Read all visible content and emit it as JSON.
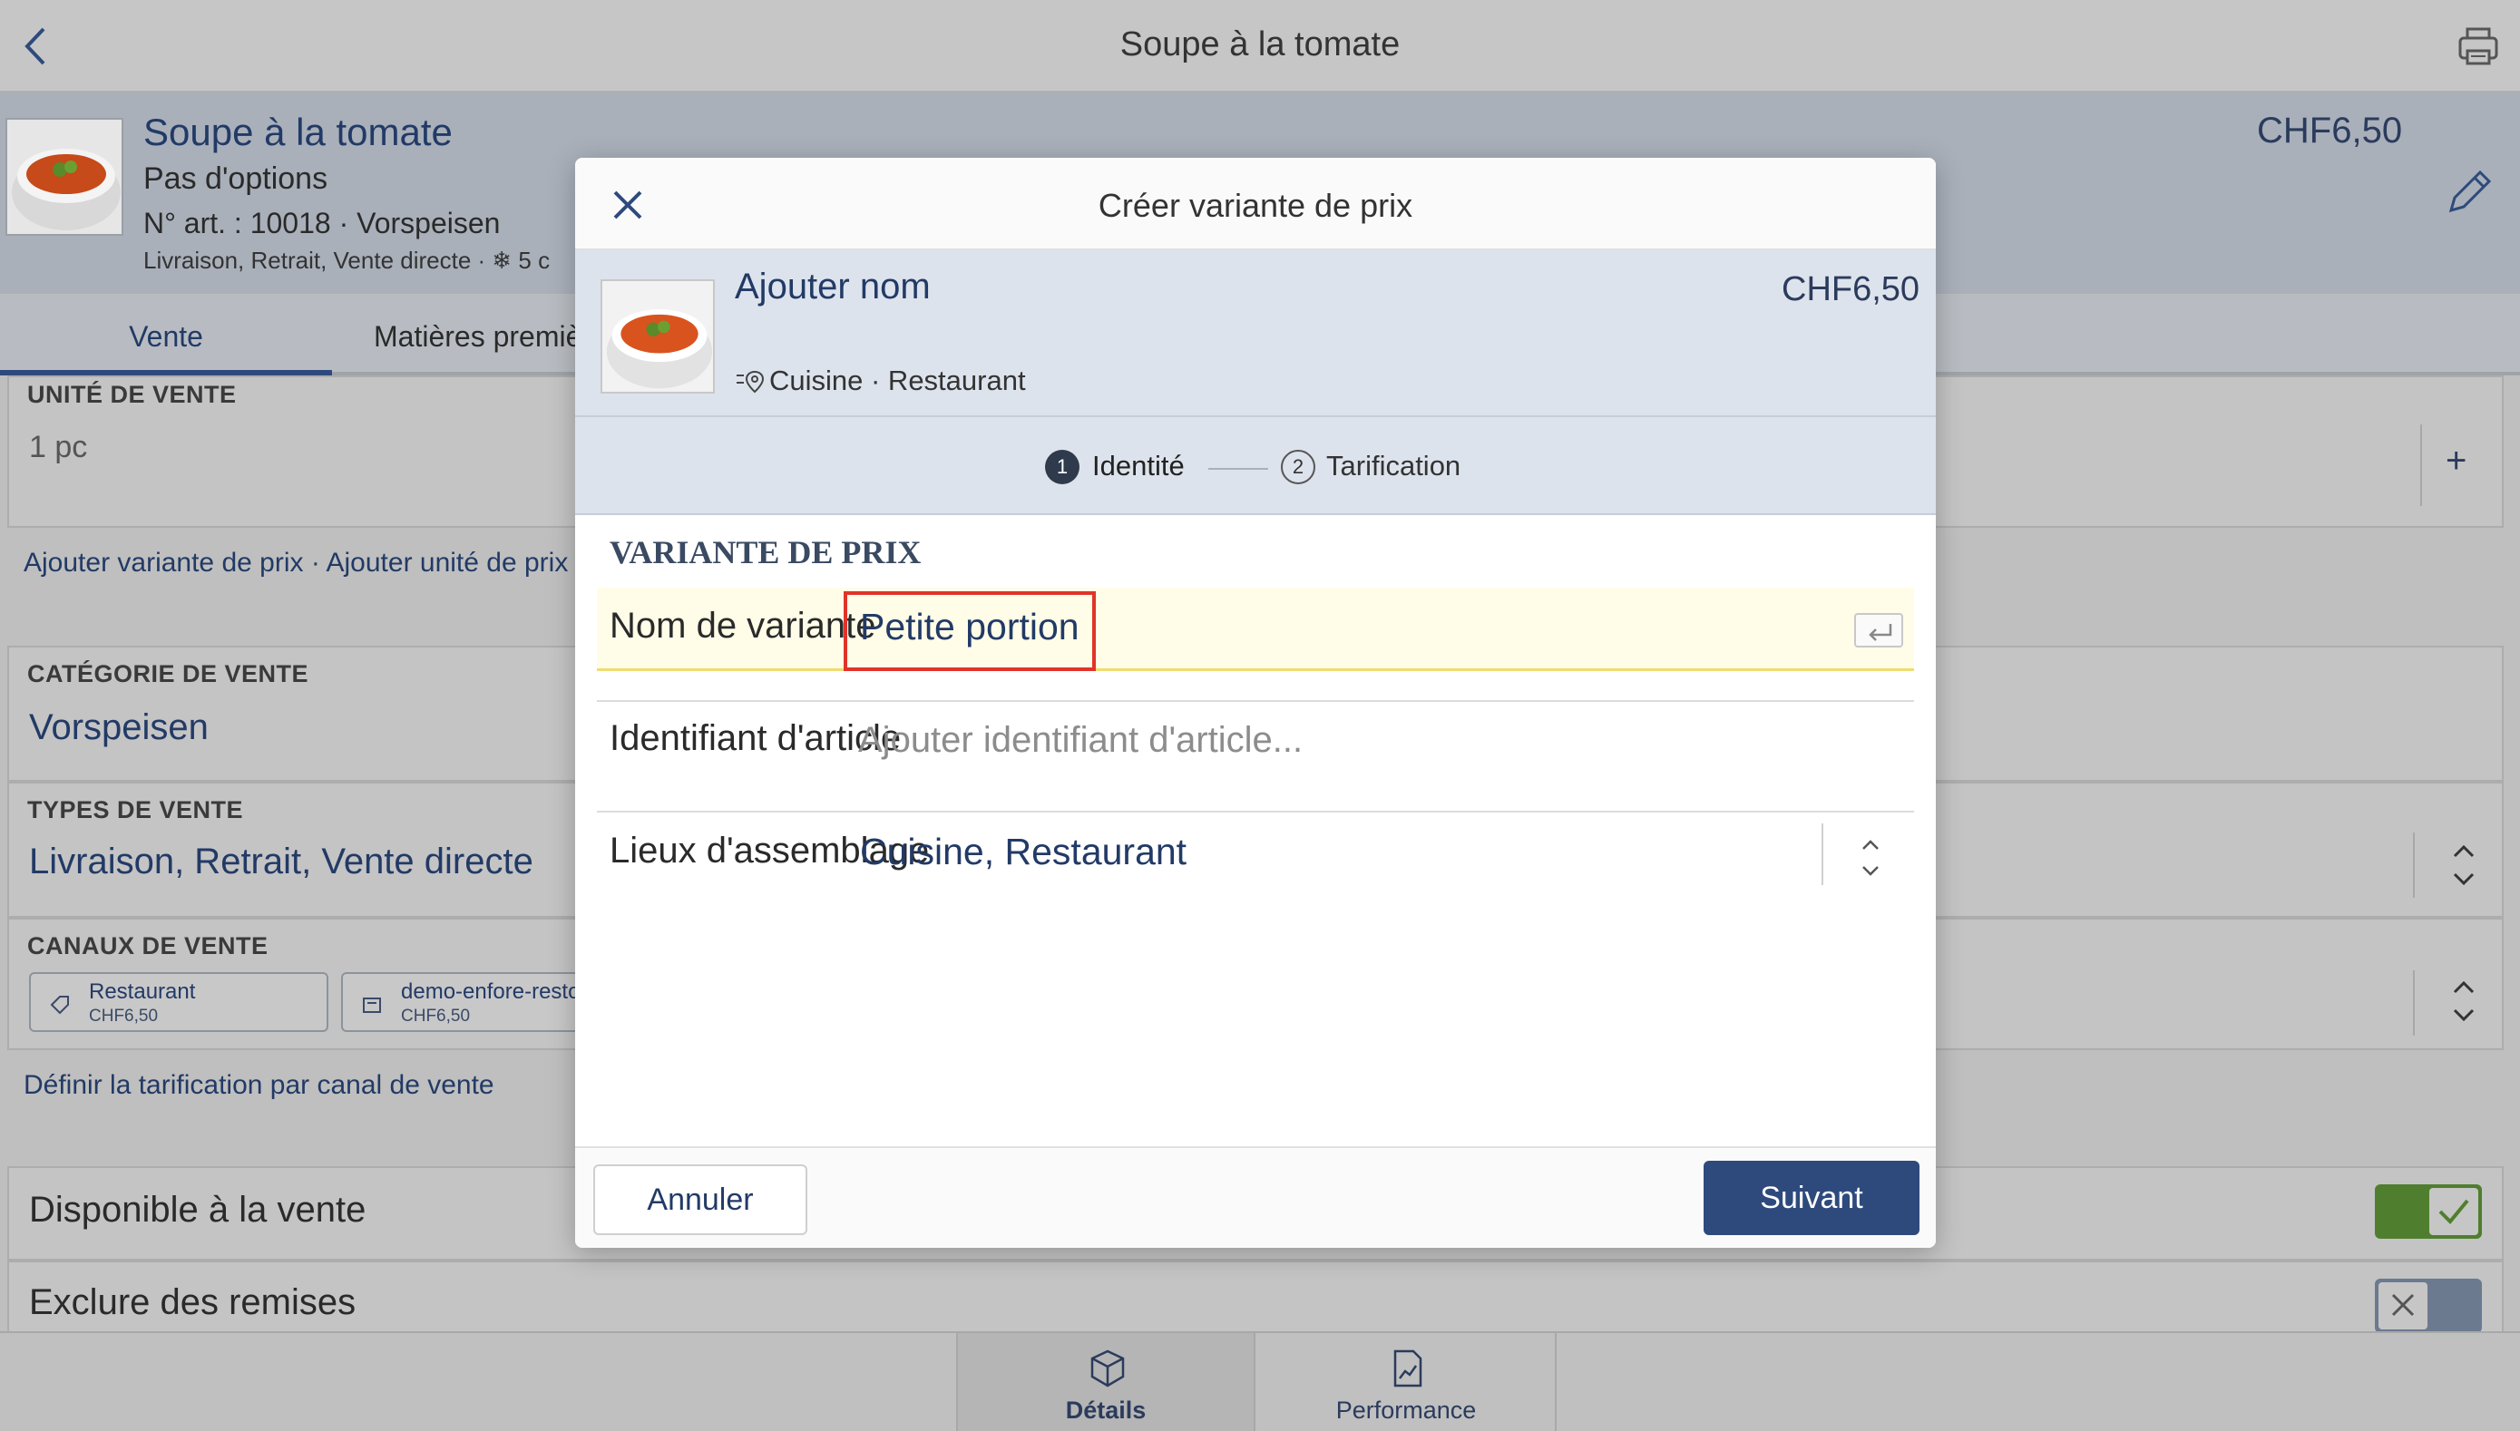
{
  "app": {
    "title": "Soupe à la tomate"
  },
  "product": {
    "name": "Soupe à la tomate",
    "options": "Pas d'options",
    "article": "N° art. : 10018 · Vorspeisen",
    "meta": "Livraison, Retrait, Vente directe · ❄ 5 c",
    "price": "CHF6,50"
  },
  "tabs": [
    {
      "label": "Vente",
      "active": true
    },
    {
      "label": "Matières premières",
      "active": false
    }
  ],
  "sale_unit": {
    "label": "UNITÉ DE VENTE",
    "value": "1 pc",
    "add": "+"
  },
  "links": {
    "add_variant_unit": "Ajouter variante de prix · Ajouter unité de prix",
    "channel_pricing": "Définir la tarification par canal de vente"
  },
  "category": {
    "label": "CATÉGORIE DE VENTE",
    "value": "Vorspeisen"
  },
  "sale_types": {
    "label": "TYPES DE VENTE",
    "value": "Livraison, Retrait, Vente directe"
  },
  "channels": {
    "label": "CANAUX DE VENTE",
    "items": [
      {
        "name": "Restaurant",
        "price": "CHF6,50"
      },
      {
        "name": "demo-enfore-resto-",
        "price": "CHF6,50"
      }
    ]
  },
  "toggles": {
    "available": {
      "label": "Disponible à la vente",
      "on": true
    },
    "exclude": {
      "label": "Exclure des remises",
      "on": false
    }
  },
  "bottom_nav": [
    {
      "label": "Détails",
      "active": true
    },
    {
      "label": "Performance",
      "active": false
    }
  ],
  "modal": {
    "title": "Créer variante de prix",
    "product_name": "Ajouter nom",
    "price": "CHF6,50",
    "locations": "Cuisine · Restaurant",
    "steps": [
      {
        "num": "1",
        "label": "Identité",
        "active": true
      },
      {
        "num": "2",
        "label": "Tarification",
        "active": false
      }
    ],
    "section_title": "VARIANTE DE PRIX",
    "fields": {
      "variant_name": {
        "label": "Nom de variante",
        "value": "Petite portion"
      },
      "item_id": {
        "label": "Identifiant d'article",
        "placeholder": "Ajouter identifiant d'article..."
      },
      "assembly": {
        "label": "Lieux d'assemblage",
        "value": "Cuisine, Restaurant"
      }
    },
    "cancel_label": "Annuler",
    "next_label": "Suivant"
  },
  "colors": {
    "primary": "#2e4a7d",
    "highlight_border": "#e0342a",
    "toggle_on": "#4f7f2e",
    "toggle_off": "#6c7a90"
  }
}
